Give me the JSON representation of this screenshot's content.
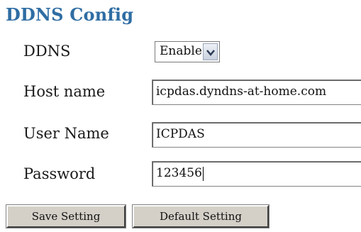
{
  "title": "DDNS Config",
  "fields": {
    "ddns": {
      "label": "DDNS",
      "value": "Enable"
    },
    "host": {
      "label": "Host name",
      "value": "icpdas.dyndns-at-home.com"
    },
    "user": {
      "label": "User Name",
      "value": "ICPDAS"
    },
    "password": {
      "label": "Password",
      "value": "123456"
    }
  },
  "buttons": {
    "save": "Save Setting",
    "default": "Default Setting"
  },
  "colors": {
    "title": "#2f6da3"
  },
  "icons": {
    "dropdown": "chevron-down-icon"
  }
}
